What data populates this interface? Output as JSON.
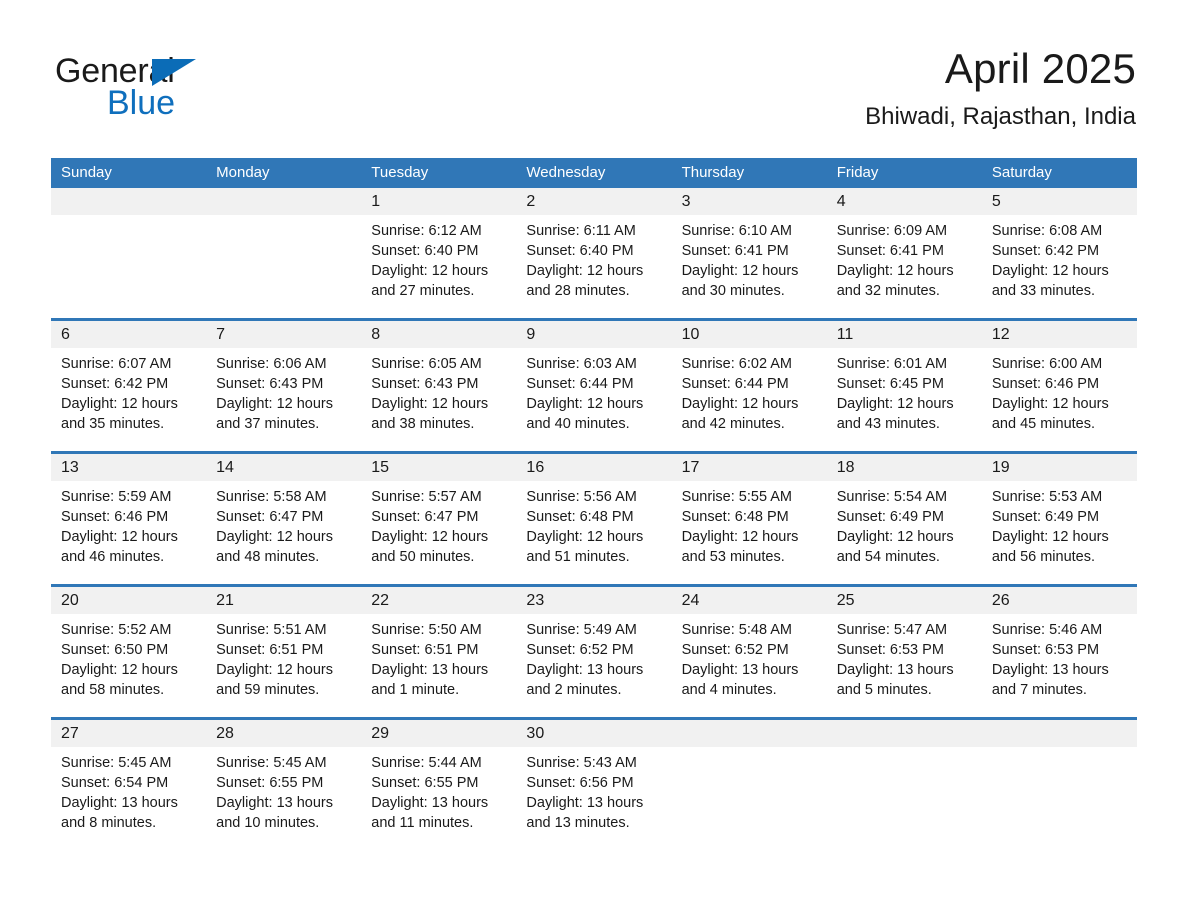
{
  "brand": {
    "name_part1": "General",
    "name_part2": "Blue",
    "triangle_color": "#0b6cb7",
    "blue_text_color": "#0f6fbd"
  },
  "header": {
    "title": "April 2025",
    "subtitle": "Bhiwadi, Rajasthan, India",
    "accent_color": "#3077b7",
    "band_color": "#f1f1f1"
  },
  "weekdays": [
    "Sunday",
    "Monday",
    "Tuesday",
    "Wednesday",
    "Thursday",
    "Friday",
    "Saturday"
  ],
  "weeks": [
    {
      "days": [
        {
          "num": "",
          "sunrise": "",
          "sunset": "",
          "daylight1": "",
          "daylight2": ""
        },
        {
          "num": "",
          "sunrise": "",
          "sunset": "",
          "daylight1": "",
          "daylight2": ""
        },
        {
          "num": "1",
          "sunrise": "Sunrise: 6:12 AM",
          "sunset": "Sunset: 6:40 PM",
          "daylight1": "Daylight: 12 hours",
          "daylight2": "and 27 minutes."
        },
        {
          "num": "2",
          "sunrise": "Sunrise: 6:11 AM",
          "sunset": "Sunset: 6:40 PM",
          "daylight1": "Daylight: 12 hours",
          "daylight2": "and 28 minutes."
        },
        {
          "num": "3",
          "sunrise": "Sunrise: 6:10 AM",
          "sunset": "Sunset: 6:41 PM",
          "daylight1": "Daylight: 12 hours",
          "daylight2": "and 30 minutes."
        },
        {
          "num": "4",
          "sunrise": "Sunrise: 6:09 AM",
          "sunset": "Sunset: 6:41 PM",
          "daylight1": "Daylight: 12 hours",
          "daylight2": "and 32 minutes."
        },
        {
          "num": "5",
          "sunrise": "Sunrise: 6:08 AM",
          "sunset": "Sunset: 6:42 PM",
          "daylight1": "Daylight: 12 hours",
          "daylight2": "and 33 minutes."
        }
      ]
    },
    {
      "days": [
        {
          "num": "6",
          "sunrise": "Sunrise: 6:07 AM",
          "sunset": "Sunset: 6:42 PM",
          "daylight1": "Daylight: 12 hours",
          "daylight2": "and 35 minutes."
        },
        {
          "num": "7",
          "sunrise": "Sunrise: 6:06 AM",
          "sunset": "Sunset: 6:43 PM",
          "daylight1": "Daylight: 12 hours",
          "daylight2": "and 37 minutes."
        },
        {
          "num": "8",
          "sunrise": "Sunrise: 6:05 AM",
          "sunset": "Sunset: 6:43 PM",
          "daylight1": "Daylight: 12 hours",
          "daylight2": "and 38 minutes."
        },
        {
          "num": "9",
          "sunrise": "Sunrise: 6:03 AM",
          "sunset": "Sunset: 6:44 PM",
          "daylight1": "Daylight: 12 hours",
          "daylight2": "and 40 minutes."
        },
        {
          "num": "10",
          "sunrise": "Sunrise: 6:02 AM",
          "sunset": "Sunset: 6:44 PM",
          "daylight1": "Daylight: 12 hours",
          "daylight2": "and 42 minutes."
        },
        {
          "num": "11",
          "sunrise": "Sunrise: 6:01 AM",
          "sunset": "Sunset: 6:45 PM",
          "daylight1": "Daylight: 12 hours",
          "daylight2": "and 43 minutes."
        },
        {
          "num": "12",
          "sunrise": "Sunrise: 6:00 AM",
          "sunset": "Sunset: 6:46 PM",
          "daylight1": "Daylight: 12 hours",
          "daylight2": "and 45 minutes."
        }
      ]
    },
    {
      "days": [
        {
          "num": "13",
          "sunrise": "Sunrise: 5:59 AM",
          "sunset": "Sunset: 6:46 PM",
          "daylight1": "Daylight: 12 hours",
          "daylight2": "and 46 minutes."
        },
        {
          "num": "14",
          "sunrise": "Sunrise: 5:58 AM",
          "sunset": "Sunset: 6:47 PM",
          "daylight1": "Daylight: 12 hours",
          "daylight2": "and 48 minutes."
        },
        {
          "num": "15",
          "sunrise": "Sunrise: 5:57 AM",
          "sunset": "Sunset: 6:47 PM",
          "daylight1": "Daylight: 12 hours",
          "daylight2": "and 50 minutes."
        },
        {
          "num": "16",
          "sunrise": "Sunrise: 5:56 AM",
          "sunset": "Sunset: 6:48 PM",
          "daylight1": "Daylight: 12 hours",
          "daylight2": "and 51 minutes."
        },
        {
          "num": "17",
          "sunrise": "Sunrise: 5:55 AM",
          "sunset": "Sunset: 6:48 PM",
          "daylight1": "Daylight: 12 hours",
          "daylight2": "and 53 minutes."
        },
        {
          "num": "18",
          "sunrise": "Sunrise: 5:54 AM",
          "sunset": "Sunset: 6:49 PM",
          "daylight1": "Daylight: 12 hours",
          "daylight2": "and 54 minutes."
        },
        {
          "num": "19",
          "sunrise": "Sunrise: 5:53 AM",
          "sunset": "Sunset: 6:49 PM",
          "daylight1": "Daylight: 12 hours",
          "daylight2": "and 56 minutes."
        }
      ]
    },
    {
      "days": [
        {
          "num": "20",
          "sunrise": "Sunrise: 5:52 AM",
          "sunset": "Sunset: 6:50 PM",
          "daylight1": "Daylight: 12 hours",
          "daylight2": "and 58 minutes."
        },
        {
          "num": "21",
          "sunrise": "Sunrise: 5:51 AM",
          "sunset": "Sunset: 6:51 PM",
          "daylight1": "Daylight: 12 hours",
          "daylight2": "and 59 minutes."
        },
        {
          "num": "22",
          "sunrise": "Sunrise: 5:50 AM",
          "sunset": "Sunset: 6:51 PM",
          "daylight1": "Daylight: 13 hours",
          "daylight2": "and 1 minute."
        },
        {
          "num": "23",
          "sunrise": "Sunrise: 5:49 AM",
          "sunset": "Sunset: 6:52 PM",
          "daylight1": "Daylight: 13 hours",
          "daylight2": "and 2 minutes."
        },
        {
          "num": "24",
          "sunrise": "Sunrise: 5:48 AM",
          "sunset": "Sunset: 6:52 PM",
          "daylight1": "Daylight: 13 hours",
          "daylight2": "and 4 minutes."
        },
        {
          "num": "25",
          "sunrise": "Sunrise: 5:47 AM",
          "sunset": "Sunset: 6:53 PM",
          "daylight1": "Daylight: 13 hours",
          "daylight2": "and 5 minutes."
        },
        {
          "num": "26",
          "sunrise": "Sunrise: 5:46 AM",
          "sunset": "Sunset: 6:53 PM",
          "daylight1": "Daylight: 13 hours",
          "daylight2": "and 7 minutes."
        }
      ]
    },
    {
      "days": [
        {
          "num": "27",
          "sunrise": "Sunrise: 5:45 AM",
          "sunset": "Sunset: 6:54 PM",
          "daylight1": "Daylight: 13 hours",
          "daylight2": "and 8 minutes."
        },
        {
          "num": "28",
          "sunrise": "Sunrise: 5:45 AM",
          "sunset": "Sunset: 6:55 PM",
          "daylight1": "Daylight: 13 hours",
          "daylight2": "and 10 minutes."
        },
        {
          "num": "29",
          "sunrise": "Sunrise: 5:44 AM",
          "sunset": "Sunset: 6:55 PM",
          "daylight1": "Daylight: 13 hours",
          "daylight2": "and 11 minutes."
        },
        {
          "num": "30",
          "sunrise": "Sunrise: 5:43 AM",
          "sunset": "Sunset: 6:56 PM",
          "daylight1": "Daylight: 13 hours",
          "daylight2": "and 13 minutes."
        },
        {
          "num": "",
          "sunrise": "",
          "sunset": "",
          "daylight1": "",
          "daylight2": ""
        },
        {
          "num": "",
          "sunrise": "",
          "sunset": "",
          "daylight1": "",
          "daylight2": ""
        },
        {
          "num": "",
          "sunrise": "",
          "sunset": "",
          "daylight1": "",
          "daylight2": ""
        }
      ]
    }
  ]
}
